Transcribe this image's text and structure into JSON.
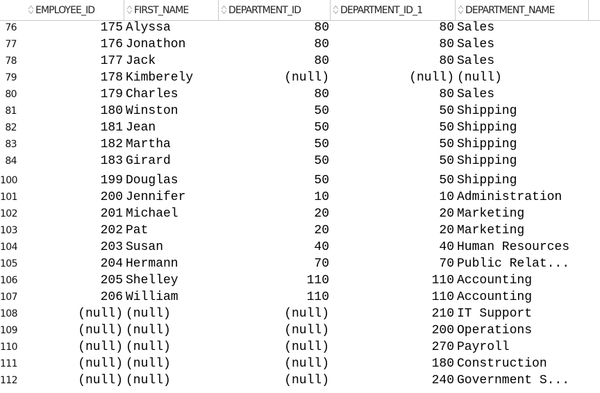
{
  "columns": [
    "EMPLOYEE_ID",
    "FIRST_NAME",
    "DEPARTMENT_ID",
    "DEPARTMENT_ID_1",
    "DEPARTMENT_NAME"
  ],
  "rows_top": [
    {
      "n": "76",
      "eid": "175",
      "fname": "Alyssa",
      "did": "80",
      "did1": "80",
      "dname": "Sales"
    },
    {
      "n": "77",
      "eid": "176",
      "fname": "Jonathon",
      "did": "80",
      "did1": "80",
      "dname": "Sales"
    },
    {
      "n": "78",
      "eid": "177",
      "fname": "Jack",
      "did": "80",
      "did1": "80",
      "dname": "Sales"
    },
    {
      "n": "79",
      "eid": "178",
      "fname": "Kimberely",
      "did": "(null)",
      "did1": "(null)",
      "dname": "(null)"
    },
    {
      "n": "80",
      "eid": "179",
      "fname": "Charles",
      "did": "80",
      "did1": "80",
      "dname": "Sales"
    },
    {
      "n": "81",
      "eid": "180",
      "fname": "Winston",
      "did": "50",
      "did1": "50",
      "dname": "Shipping"
    },
    {
      "n": "82",
      "eid": "181",
      "fname": "Jean",
      "did": "50",
      "did1": "50",
      "dname": "Shipping"
    },
    {
      "n": "83",
      "eid": "182",
      "fname": "Martha",
      "did": "50",
      "did1": "50",
      "dname": "Shipping"
    },
    {
      "n": "84",
      "eid": "183",
      "fname": "Girard",
      "did": "50",
      "did1": "50",
      "dname": "Shipping"
    }
  ],
  "rows_bottom": [
    {
      "n": "100",
      "eid": "199",
      "fname": "Douglas",
      "did": "50",
      "did1": "50",
      "dname": "Shipping"
    },
    {
      "n": "101",
      "eid": "200",
      "fname": "Jennifer",
      "did": "10",
      "did1": "10",
      "dname": "Administration"
    },
    {
      "n": "102",
      "eid": "201",
      "fname": "Michael",
      "did": "20",
      "did1": "20",
      "dname": "Marketing"
    },
    {
      "n": "103",
      "eid": "202",
      "fname": "Pat",
      "did": "20",
      "did1": "20",
      "dname": "Marketing"
    },
    {
      "n": "104",
      "eid": "203",
      "fname": "Susan",
      "did": "40",
      "did1": "40",
      "dname": "Human Resources"
    },
    {
      "n": "105",
      "eid": "204",
      "fname": "Hermann",
      "did": "70",
      "did1": "70",
      "dname": "Public Relat..."
    },
    {
      "n": "106",
      "eid": "205",
      "fname": "Shelley",
      "did": "110",
      "did1": "110",
      "dname": "Accounting"
    },
    {
      "n": "107",
      "eid": "206",
      "fname": "William",
      "did": "110",
      "did1": "110",
      "dname": "Accounting"
    },
    {
      "n": "108",
      "eid": "(null)",
      "fname": "(null)",
      "did": "(null)",
      "did1": "210",
      "dname": "IT Support"
    },
    {
      "n": "109",
      "eid": "(null)",
      "fname": "(null)",
      "did": "(null)",
      "did1": "200",
      "dname": "Operations"
    },
    {
      "n": "110",
      "eid": "(null)",
      "fname": "(null)",
      "did": "(null)",
      "did1": "270",
      "dname": "Payroll"
    },
    {
      "n": "111",
      "eid": "(null)",
      "fname": "(null)",
      "did": "(null)",
      "did1": "180",
      "dname": "Construction"
    },
    {
      "n": "112",
      "eid": "(null)",
      "fname": "(null)",
      "did": "(null)",
      "did1": "240",
      "dname": "Government S..."
    }
  ]
}
